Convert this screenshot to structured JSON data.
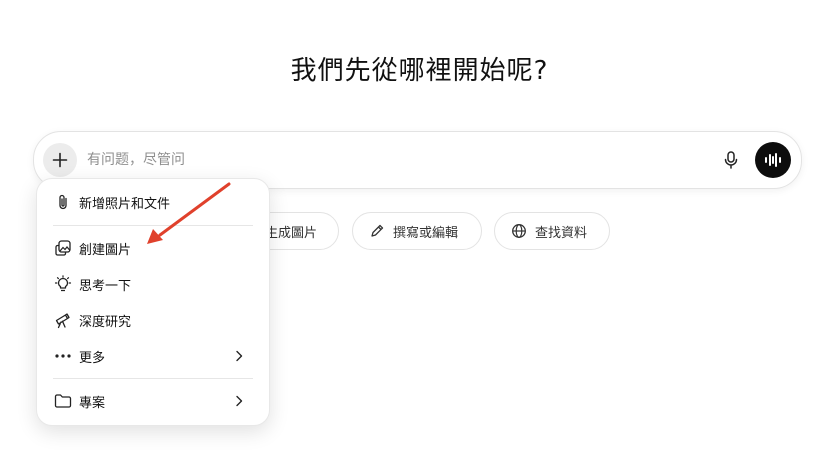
{
  "headline": "我們先從哪裡開始呢?",
  "composer": {
    "placeholder": "有问题，尽管问"
  },
  "chips": [
    {
      "label": "生成圖片",
      "icon": "image-icon"
    },
    {
      "label": "撰寫或編輯",
      "icon": "pencil-icon"
    },
    {
      "label": "查找資料",
      "icon": "globe-icon"
    }
  ],
  "menu": {
    "items": [
      {
        "label": "新增照片和文件",
        "icon": "paperclip-icon"
      },
      {
        "label": "創建圖片",
        "icon": "image-icon"
      },
      {
        "label": "思考一下",
        "icon": "lightbulb-icon"
      },
      {
        "label": "深度研究",
        "icon": "telescope-icon"
      },
      {
        "label": "更多",
        "icon": "more-icon"
      },
      {
        "label": "專案",
        "icon": "folder-icon"
      }
    ]
  },
  "colors": {
    "annotation_arrow": "#e0412c",
    "voice_button": "#0d0d0d"
  }
}
